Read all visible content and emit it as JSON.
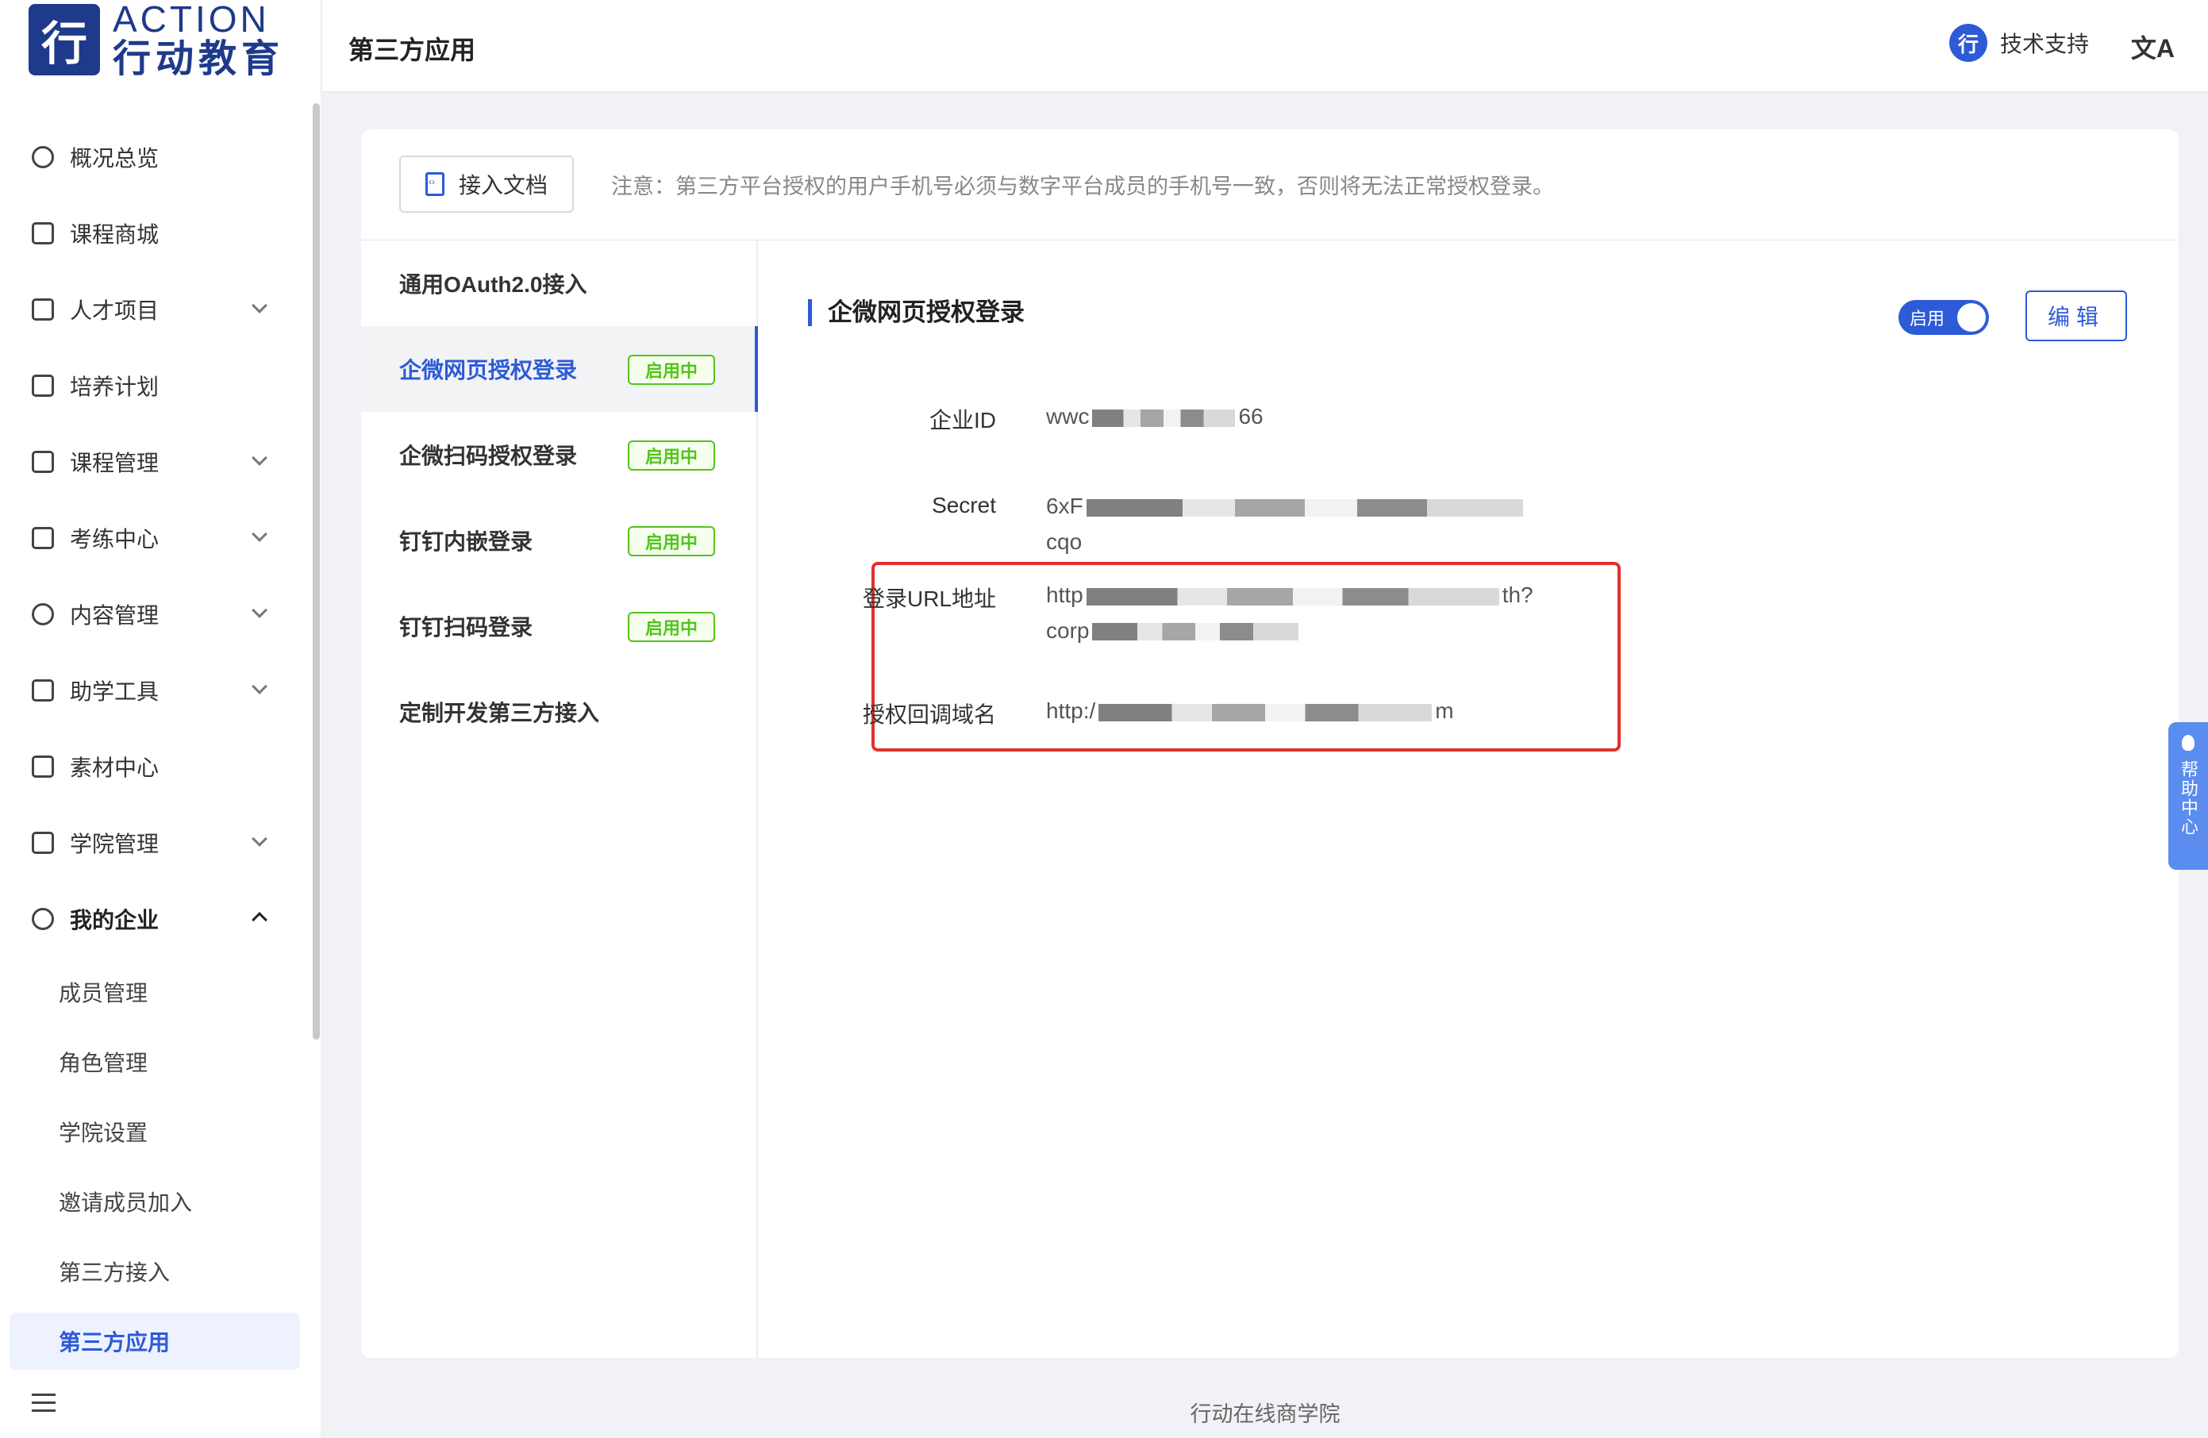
{
  "brand": {
    "en": "ACTION",
    "cn": "行动教育",
    "mark": "行"
  },
  "sidebar": {
    "items": [
      {
        "label": "概况总览",
        "icon": "pie-chart-icon",
        "has_children": false
      },
      {
        "label": "课程商城",
        "icon": "store-icon",
        "has_children": false
      },
      {
        "label": "人才项目",
        "icon": "line-chart-icon",
        "has_children": true
      },
      {
        "label": "培养计划",
        "icon": "calendar-icon",
        "has_children": false
      },
      {
        "label": "课程管理",
        "icon": "book-icon",
        "has_children": true
      },
      {
        "label": "考练中心",
        "icon": "exam-icon",
        "has_children": true
      },
      {
        "label": "内容管理",
        "icon": "inbox-icon",
        "has_children": true
      },
      {
        "label": "助学工具",
        "icon": "notebook-icon",
        "has_children": true
      },
      {
        "label": "素材中心",
        "icon": "folder-icon",
        "has_children": false
      },
      {
        "label": "学院管理",
        "icon": "bank-icon",
        "has_children": true
      },
      {
        "label": "我的企业",
        "icon": "gear-icon",
        "has_children": true,
        "expanded": true
      }
    ],
    "submenu": [
      {
        "label": "成员管理"
      },
      {
        "label": "角色管理"
      },
      {
        "label": "学院设置"
      },
      {
        "label": "邀请成员加入"
      },
      {
        "label": "第三方接入"
      },
      {
        "label": "第三方应用",
        "active": true
      }
    ]
  },
  "header": {
    "title": "第三方应用",
    "support_label": "技术支持",
    "support_icon_text": "行",
    "translate_icon": "文A"
  },
  "toolbar": {
    "doc_button": "接入文档",
    "notice": "注意：第三方平台授权的用户手机号必须与数字平台成员的手机号一致，否则将无法正常授权登录。"
  },
  "nav": [
    {
      "label": "通用OAuth2.0接入",
      "status": ""
    },
    {
      "label": "企微网页授权登录",
      "status": "启用中",
      "active": true
    },
    {
      "label": "企微扫码授权登录",
      "status": "启用中"
    },
    {
      "label": "钉钉内嵌登录",
      "status": "启用中"
    },
    {
      "label": "钉钉扫码登录",
      "status": "启用中"
    },
    {
      "label": "定制开发第三方接入",
      "status": ""
    }
  ],
  "detail": {
    "title": "企微网页授权登录",
    "toggle_label": "启用",
    "toggle_on": true,
    "edit_label": "编辑",
    "fields": [
      {
        "label": "企业ID",
        "value_start": "wwc",
        "value_end": "66"
      },
      {
        "label": "Secret",
        "value_start": "6xF",
        "value_end": "cqo"
      },
      {
        "label": "登录URL地址",
        "value_start": "http",
        "value_mid_end": "th?",
        "value_line2": "corp"
      },
      {
        "label": "授权回调域名",
        "value_start": "http:/",
        "value_end": "m"
      }
    ]
  },
  "footer": {
    "text": "行动在线商学院"
  },
  "help": {
    "label": "帮助中心"
  },
  "colors": {
    "accent": "#2d5bd7",
    "success": "#52c41a",
    "highlight": "#e0302c"
  }
}
